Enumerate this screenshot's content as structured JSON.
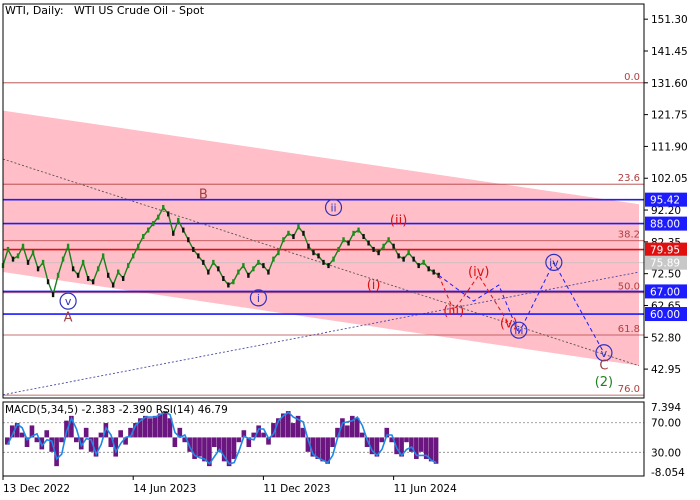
{
  "chart_data": {
    "type": "line",
    "header": {
      "symbol": "WTI, Daily:",
      "instrument": "WTI US Crude Oil - Spot"
    },
    "price_axis": {
      "ylim": [
        34.0,
        156.0
      ],
      "ticks": [
        151.3,
        141.45,
        131.6,
        121.75,
        111.9,
        102.05,
        92.2,
        82.35,
        72.5,
        62.65,
        52.8,
        42.95
      ],
      "tick_labels": [
        "151.30",
        "141.45",
        "131.60",
        "121.75",
        "111.90",
        "102.05",
        "92.20",
        "82.35",
        "72.50",
        "62.65",
        "52.80",
        "42.95"
      ]
    },
    "time_axis": {
      "labels": [
        {
          "t": 0,
          "text": "13 Dec 2022"
        },
        {
          "t": 26,
          "text": "14 Jun 2023"
        },
        {
          "t": 52,
          "text": "11 Dec 2023"
        },
        {
          "t": 78,
          "text": "11 Jun 2024"
        }
      ],
      "t_range": [
        0,
        128
      ]
    },
    "price_series": {
      "name": "WTI",
      "t": [
        0,
        1,
        2,
        3,
        4,
        5,
        6,
        7,
        8,
        9,
        10,
        11,
        12,
        13,
        14,
        15,
        16,
        17,
        18,
        19,
        20,
        21,
        22,
        23,
        24,
        25,
        26,
        27,
        28,
        29,
        30,
        31,
        32,
        33,
        34,
        35,
        36,
        37,
        38,
        39,
        40,
        41,
        42,
        43,
        44,
        45,
        46,
        47,
        48,
        49,
        50,
        51,
        52,
        53,
        54,
        55,
        56,
        57,
        58,
        59,
        60,
        61,
        62,
        63,
        64,
        65,
        66,
        67,
        68,
        69,
        70,
        71,
        72,
        73,
        74,
        75,
        76,
        77,
        78,
        79,
        80,
        81,
        82,
        83,
        84,
        85,
        86,
        87
      ],
      "values": [
        75,
        80,
        77,
        78,
        81,
        76,
        79,
        74,
        76,
        70,
        66,
        72,
        77,
        81,
        74,
        72,
        76,
        71,
        70,
        74,
        78,
        72,
        69,
        73,
        71,
        75,
        78,
        81,
        84,
        86,
        88,
        90,
        93,
        91,
        85,
        89,
        86,
        83,
        80,
        78,
        76,
        73,
        76,
        74,
        71,
        69,
        70,
        73,
        75,
        72,
        74,
        76,
        75,
        73,
        77,
        79,
        83,
        85,
        84,
        87,
        85,
        81,
        79,
        78,
        76,
        75,
        77,
        80,
        83,
        82,
        85,
        86,
        84,
        82,
        80,
        79,
        81,
        83,
        81,
        78,
        77,
        79,
        77,
        75,
        76,
        74,
        73,
        72
      ]
    },
    "horizontal_levels": [
      {
        "value": 95.42,
        "label": "95.42",
        "color": "#1c1cff",
        "label_bg": "#1c1cff"
      },
      {
        "value": 88.0,
        "label": "88.00",
        "color": "#1c1cff",
        "label_bg": "#1c1cff"
      },
      {
        "value": 79.95,
        "label": "79.95",
        "color": "#e01010",
        "label_bg": "#e01010"
      },
      {
        "value": 75.89,
        "label": "75.89",
        "color": "#c0c0c0",
        "label_bg": "#c8c8c8"
      },
      {
        "value": 67.0,
        "label": "67.00",
        "color": "#1c1cff",
        "label_bg": "#1c1cff"
      },
      {
        "value": 60.0,
        "label": "60.00",
        "color": "#1c1cff",
        "label_bg": "#1c1cff"
      }
    ],
    "fibonacci_levels": [
      {
        "value": 131.6,
        "label": "0.0"
      },
      {
        "value": 100.2,
        "label": "23.6"
      },
      {
        "value": 82.7,
        "label": "38.2"
      },
      {
        "value": 66.6,
        "label": "50.0"
      },
      {
        "value": 53.5,
        "label": "61.8"
      },
      {
        "value": 34.9,
        "label": "76.0"
      }
    ],
    "channel": {
      "upper": [
        [
          0,
          123
        ],
        [
          127,
          94
        ]
      ],
      "lower": [
        [
          0,
          73
        ],
        [
          127,
          44
        ]
      ],
      "color": "#ffb3be"
    },
    "wave_labels": [
      {
        "text": "v",
        "t": 13,
        "value": 64,
        "color": "#3030c0",
        "circled": true
      },
      {
        "text": "A",
        "t": 13,
        "value": 59,
        "color": "#a04040",
        "circled": false
      },
      {
        "text": "B",
        "t": 40,
        "value": 97,
        "color": "#a04040",
        "circled": false
      },
      {
        "text": "i",
        "t": 51,
        "value": 65,
        "color": "#3030c0",
        "circled": true
      },
      {
        "text": "ii",
        "t": 66,
        "value": 93,
        "color": "#3030c0",
        "circled": true
      },
      {
        "text": "(ii)",
        "t": 79,
        "value": 89,
        "color": "#e01010",
        "circled": false
      },
      {
        "text": "(i)",
        "t": 74,
        "value": 69,
        "color": "#e01010",
        "circled": false
      },
      {
        "text": "(iv)",
        "t": 95,
        "value": 73,
        "color": "#e01010",
        "circled": false
      },
      {
        "text": "(iii)",
        "t": 90,
        "value": 61,
        "color": "#e01010",
        "circled": false
      },
      {
        "text": "(v)",
        "t": 101,
        "value": 57,
        "color": "#e01010",
        "circled": false
      },
      {
        "text": "iii",
        "t": 103,
        "value": 55,
        "color": "#3030c0",
        "circled": true
      },
      {
        "text": "iv",
        "t": 110,
        "value": 76,
        "color": "#3030c0",
        "circled": true
      },
      {
        "text": "v",
        "t": 120,
        "value": 48,
        "color": "#3030c0",
        "circled": true
      },
      {
        "text": "C",
        "t": 120,
        "value": 44,
        "color": "#a04040",
        "circled": false
      },
      {
        "text": "(2)",
        "t": 120,
        "value": 39,
        "color": "#208020",
        "circled": false
      }
    ],
    "forecast_path": {
      "points": [
        [
          87,
          72
        ],
        [
          94,
          64
        ],
        [
          99,
          69
        ],
        [
          103,
          54
        ],
        [
          110,
          76
        ],
        [
          120,
          48
        ]
      ],
      "color": "#1c1cff"
    },
    "red_forecast_path": {
      "points": [
        [
          87,
          72
        ],
        [
          90,
          61
        ],
        [
          95,
          72
        ],
        [
          101,
          57
        ]
      ],
      "color": "#e01010"
    },
    "trend_lines": [
      {
        "points": [
          [
            0,
            108
          ],
          [
            127,
            44
          ]
        ],
        "color": "#555555"
      },
      {
        "points": [
          [
            0,
            35
          ],
          [
            127,
            73
          ]
        ],
        "color": "#4a4aa0"
      }
    ],
    "indicator": {
      "label": "MACD(5,34,5) -2.383 -2.390 RSI(14) 46.79",
      "ylim": [
        -8.054,
        7.394
      ],
      "ticks": [
        7.394,
        -8.054
      ],
      "tick_labels": [
        "7.394",
        "-8.054"
      ],
      "rsi_levels": [
        {
          "label": "70.00"
        },
        {
          "label": "30.00"
        }
      ],
      "histogram": [
        -1.5,
        2.5,
        3,
        1,
        -2,
        2.5,
        -1,
        -2.5,
        1.5,
        -3,
        -6,
        -1,
        3.5,
        4.5,
        -1,
        -2.5,
        2,
        -3,
        -4,
        1,
        3,
        -2,
        -4,
        1.5,
        -1.5,
        2,
        3,
        4,
        4.5,
        4,
        4.5,
        5,
        5.5,
        4,
        -2,
        2,
        -1,
        -3,
        -4.5,
        -4,
        -5,
        -6,
        -2,
        -3,
        -5,
        -6,
        -4.5,
        -1,
        1.5,
        -2,
        1,
        2.5,
        1,
        -1.5,
        3,
        4,
        5,
        5.5,
        3,
        4.5,
        2,
        -3,
        -4,
        -4.5,
        -5,
        -5.5,
        -2,
        2,
        4,
        2.5,
        4.5,
        4,
        1,
        -2,
        -3.5,
        -4,
        -1,
        2,
        -1,
        -3.5,
        -4,
        -1,
        -3,
        -4.5,
        -3,
        -4.5,
        -5,
        -5.5
      ],
      "hist_color": "#6b1680",
      "line_color": "#1e88e5"
    }
  }
}
